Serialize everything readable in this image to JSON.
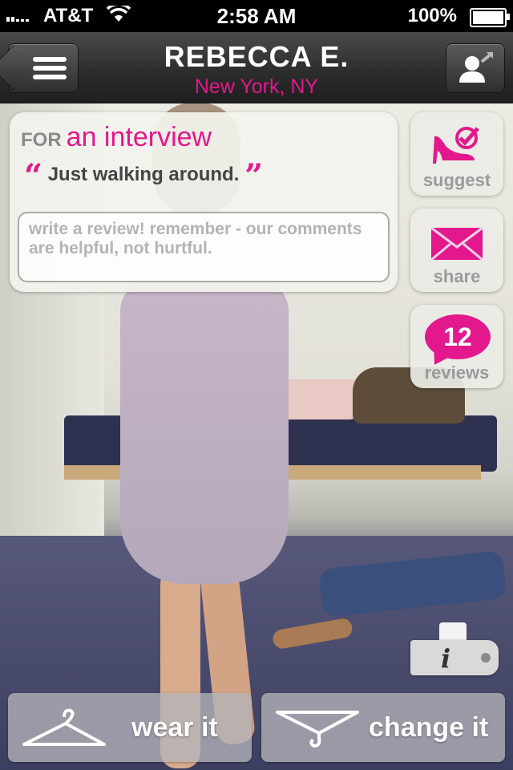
{
  "status_bar": {
    "carrier": "AT&T",
    "time": "2:58 AM",
    "battery": "100%"
  },
  "header": {
    "name": "REBECCA E.",
    "location": "New York, NY"
  },
  "card": {
    "for_label": "FOR",
    "occasion": "an interview",
    "quote": "Just walking around.",
    "review_placeholder": "write a review!  remember - our comments are helpful, not hurtful."
  },
  "side_actions": {
    "suggest_label": "suggest",
    "share_label": "share",
    "reviews_count": "12",
    "reviews_label": "reviews"
  },
  "info_tag": {
    "label": "i"
  },
  "bottom_actions": {
    "wear_label": "wear it",
    "change_label": "change it"
  },
  "colors": {
    "accent": "#e2188c"
  }
}
